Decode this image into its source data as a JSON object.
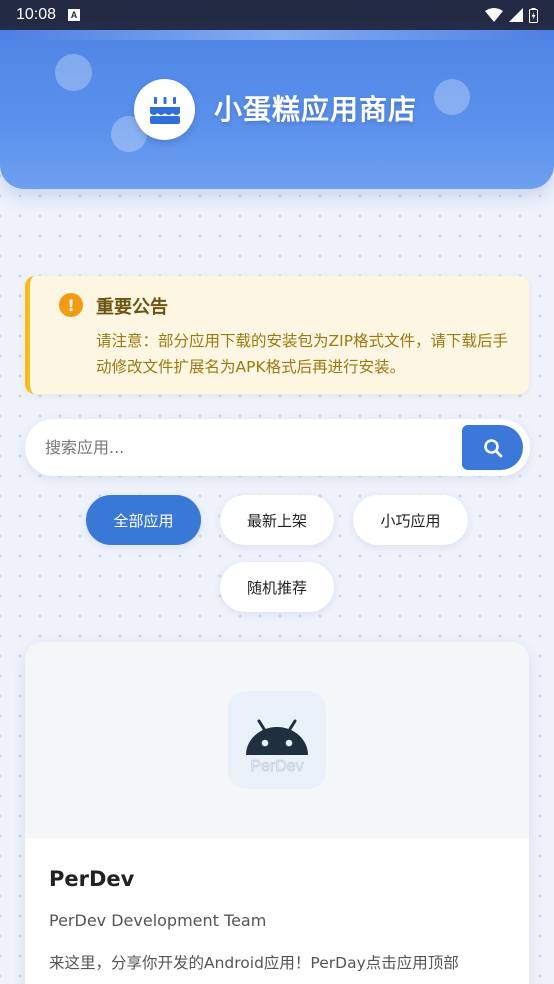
{
  "status_bar": {
    "time": "10:08",
    "icons": [
      "notification-a-icon",
      "wifi-icon",
      "signal-icon",
      "battery-icon"
    ]
  },
  "header": {
    "title": "小蛋糕应用商店",
    "logo_icon": "birthday-cake-icon",
    "colors": {
      "accent": "#4f86e6"
    }
  },
  "notice": {
    "icon": "exclamation-icon",
    "title": "重要公告",
    "text": "请注意：部分应用下载的安装包为ZIP格式文件，请下载后手动修改文件扩展名为APK格式后再进行安装。"
  },
  "search": {
    "placeholder": "搜索应用...",
    "value": "",
    "button_icon": "search-icon"
  },
  "filters": [
    {
      "label": "全部应用",
      "active": true
    },
    {
      "label": "最新上架",
      "active": false
    },
    {
      "label": "小巧应用",
      "active": false
    },
    {
      "label": "随机推荐",
      "active": false
    }
  ],
  "apps": [
    {
      "name": "PerDev",
      "icon": "android-icon",
      "icon_caption": "PerDev",
      "developer": "PerDev Development Team",
      "description": "来这里，分享你开发的Android应用！PerDay点击应用顶部"
    }
  ]
}
